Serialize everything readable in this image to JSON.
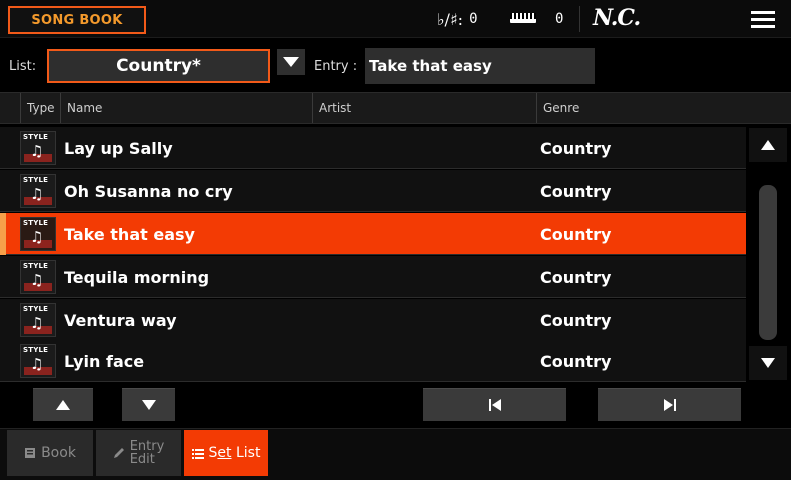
{
  "header": {
    "title": "SONG BOOK",
    "transpose_symbol": "♭/♯:",
    "transpose_value": "0",
    "octave_value": "0",
    "chord": "N.C."
  },
  "list": {
    "label": "List:",
    "value": "Country*"
  },
  "entry": {
    "label": "Entry :",
    "value": "Take that easy"
  },
  "columns": {
    "type": "Type",
    "name": "Name",
    "artist": "Artist",
    "genre": "Genre"
  },
  "rows": [
    {
      "icon_label": "STYLE",
      "name": "Lay up Sally",
      "artist": "",
      "genre": "Country",
      "selected": false
    },
    {
      "icon_label": "STYLE",
      "name": "Oh Susanna no cry",
      "artist": "",
      "genre": "Country",
      "selected": false
    },
    {
      "icon_label": "STYLE",
      "name": "Take that easy",
      "artist": "",
      "genre": "Country",
      "selected": true
    },
    {
      "icon_label": "STYLE",
      "name": "Tequila morning",
      "artist": "",
      "genre": "Country",
      "selected": false
    },
    {
      "icon_label": "STYLE",
      "name": "Ventura way",
      "artist": "",
      "genre": "Country",
      "selected": false
    },
    {
      "icon_label": "STYLE",
      "name": "Lyin face",
      "artist": "",
      "genre": "Country",
      "selected": false
    }
  ],
  "tabs": {
    "book": "Book",
    "entry_edit_1": "Entry",
    "entry_edit_2": "Edit",
    "set_list_pre": "S",
    "set_list_underlined": "et",
    "set_list_post": " List"
  },
  "colors": {
    "accent": "#f33b04",
    "outline": "#f25a19",
    "title_text": "#f49a2c"
  }
}
